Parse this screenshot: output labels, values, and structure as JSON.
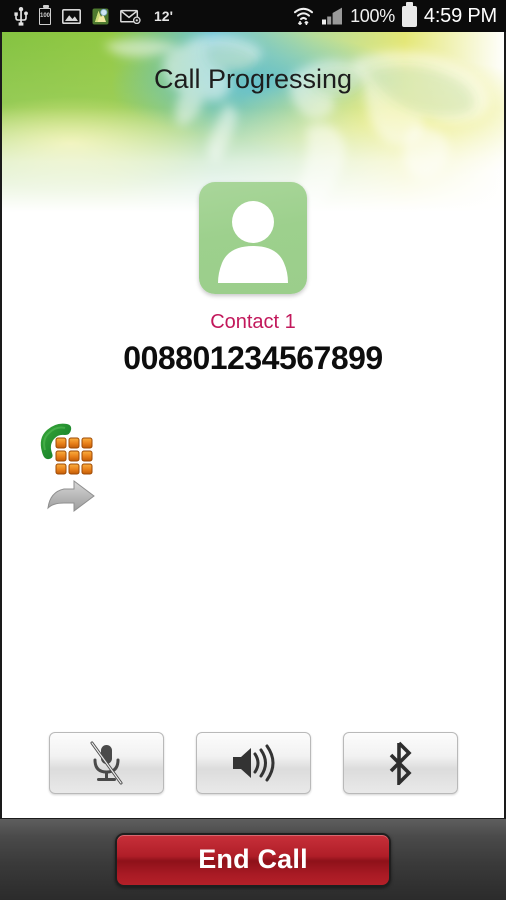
{
  "status_bar": {
    "icons_left": [
      {
        "name": "usb-icon",
        "glyph": "usb"
      },
      {
        "name": "battery-100-icon",
        "glyph": "100"
      },
      {
        "name": "screenshot-image-icon",
        "glyph": "image"
      },
      {
        "name": "maps-app-icon",
        "glyph": "map"
      },
      {
        "name": "email-icon",
        "glyph": "envelope"
      }
    ],
    "temperature": "12'",
    "wifi_icon": "wifi-icon",
    "signal_icon": "cellular-signal-icon",
    "battery_percent": "100%",
    "battery_icon": "battery-full-icon",
    "clock": "4:59 PM"
  },
  "header": {
    "title": "Call Progressing",
    "background": "world-map-gradient",
    "colors": {
      "green": "#8cc63f",
      "teal": "#6fc5d8",
      "yellow": "#e7e86a",
      "white": "#ffffff"
    }
  },
  "contact": {
    "avatar_icon": "contact-avatar-placeholder-icon",
    "avatar_color": "#9dd08d",
    "name": "Contact 1",
    "name_color": "#c2185b",
    "number": "008801234567899"
  },
  "side_actions": [
    {
      "name": "dialpad-icon",
      "label": "Dialpad"
    },
    {
      "name": "forward-arrow-icon",
      "label": "Forward"
    }
  ],
  "controls": [
    {
      "name": "mute-button",
      "icon": "mic-muted-icon",
      "label": "Mute"
    },
    {
      "name": "speaker-button",
      "icon": "speaker-icon",
      "label": "Speaker"
    },
    {
      "name": "bluetooth-button",
      "icon": "bluetooth-icon",
      "label": "Bluetooth"
    }
  ],
  "bottom_bar": {
    "end_call_label": "End Call",
    "end_call_color": "#b01e28"
  }
}
